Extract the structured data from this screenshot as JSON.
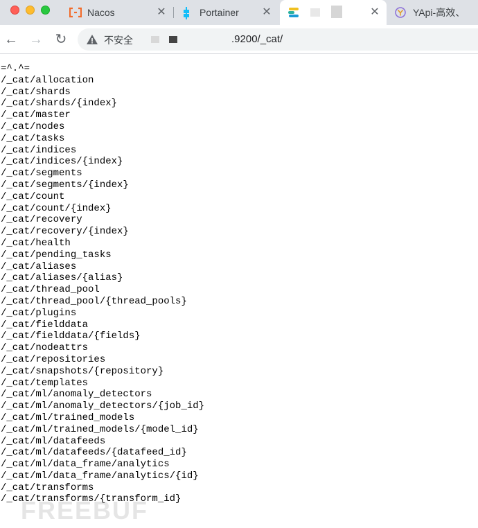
{
  "tabs": [
    {
      "title": "Nacos",
      "favicon": "nacos-icon"
    },
    {
      "title": "Portainer",
      "favicon": "portainer-icon"
    },
    {
      "title": "",
      "favicon": "elastic-icon",
      "active": true
    },
    {
      "title": "YApi-高效、",
      "favicon": "yapi-icon"
    }
  ],
  "toolbar": {
    "security_label": "不安全",
    "url": ".9200/_cat/"
  },
  "content": {
    "lines": [
      "=^.^=",
      "/_cat/allocation",
      "/_cat/shards",
      "/_cat/shards/{index}",
      "/_cat/master",
      "/_cat/nodes",
      "/_cat/tasks",
      "/_cat/indices",
      "/_cat/indices/{index}",
      "/_cat/segments",
      "/_cat/segments/{index}",
      "/_cat/count",
      "/_cat/count/{index}",
      "/_cat/recovery",
      "/_cat/recovery/{index}",
      "/_cat/health",
      "/_cat/pending_tasks",
      "/_cat/aliases",
      "/_cat/aliases/{alias}",
      "/_cat/thread_pool",
      "/_cat/thread_pool/{thread_pools}",
      "/_cat/plugins",
      "/_cat/fielddata",
      "/_cat/fielddata/{fields}",
      "/_cat/nodeattrs",
      "/_cat/repositories",
      "/_cat/snapshots/{repository}",
      "/_cat/templates",
      "/_cat/ml/anomaly_detectors",
      "/_cat/ml/anomaly_detectors/{job_id}",
      "/_cat/ml/trained_models",
      "/_cat/ml/trained_models/{model_id}",
      "/_cat/ml/datafeeds",
      "/_cat/ml/datafeeds/{datafeed_id}",
      "/_cat/ml/data_frame/analytics",
      "/_cat/ml/data_frame/analytics/{id}",
      "/_cat/transforms",
      "/_cat/transforms/{transform_id}"
    ]
  },
  "watermark": "FREEBUF",
  "colors": {
    "tabbar_bg": "#dee1e6",
    "omnibox_bg": "#f1f3f4",
    "nacos_orange": "#f26b2a",
    "portainer_blue": "#13bef9"
  }
}
